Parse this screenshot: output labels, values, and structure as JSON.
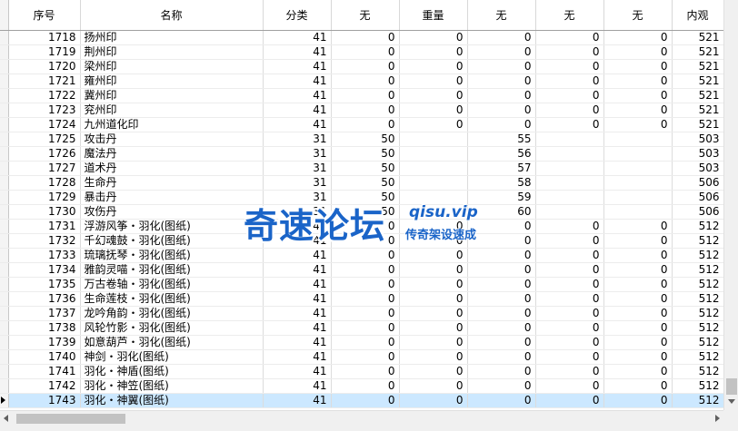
{
  "columns": [
    "序号",
    "名称",
    "分类",
    "无",
    "重量",
    "无",
    "无",
    "无",
    "内观"
  ],
  "rows": [
    [
      "1718",
      "扬州印",
      "41",
      "0",
      "0",
      "0",
      "0",
      "0",
      "521"
    ],
    [
      "1719",
      "荆州印",
      "41",
      "0",
      "0",
      "0",
      "0",
      "0",
      "521"
    ],
    [
      "1720",
      "梁州印",
      "41",
      "0",
      "0",
      "0",
      "0",
      "0",
      "521"
    ],
    [
      "1721",
      "雍州印",
      "41",
      "0",
      "0",
      "0",
      "0",
      "0",
      "521"
    ],
    [
      "1722",
      "冀州印",
      "41",
      "0",
      "0",
      "0",
      "0",
      "0",
      "521"
    ],
    [
      "1723",
      "兖州印",
      "41",
      "0",
      "0",
      "0",
      "0",
      "0",
      "521"
    ],
    [
      "1724",
      "九州道化印",
      "41",
      "0",
      "0",
      "0",
      "0",
      "0",
      "521"
    ],
    [
      "1725",
      "攻击丹",
      "31",
      "50",
      "",
      "55",
      "",
      "",
      "503"
    ],
    [
      "1726",
      "魔法丹",
      "31",
      "50",
      "",
      "56",
      "",
      "",
      "503"
    ],
    [
      "1727",
      "道术丹",
      "31",
      "50",
      "",
      "57",
      "",
      "",
      "503"
    ],
    [
      "1728",
      "生命丹",
      "31",
      "50",
      "",
      "58",
      "",
      "",
      "506"
    ],
    [
      "1729",
      "暴击丹",
      "31",
      "50",
      "",
      "59",
      "",
      "",
      "506"
    ],
    [
      "1730",
      "攻伤丹",
      "31",
      "50",
      "",
      "60",
      "",
      "",
      "506"
    ],
    [
      "1731",
      "浮游风筝・羽化(图纸)",
      "41",
      "0",
      "0",
      "0",
      "0",
      "0",
      "512"
    ],
    [
      "1732",
      "千幻魂鼓・羽化(图纸)",
      "41",
      "0",
      "0",
      "0",
      "0",
      "0",
      "512"
    ],
    [
      "1733",
      "琉璃抚琴・羽化(图纸)",
      "41",
      "0",
      "0",
      "0",
      "0",
      "0",
      "512"
    ],
    [
      "1734",
      "雅韵灵喵・羽化(图纸)",
      "41",
      "0",
      "0",
      "0",
      "0",
      "0",
      "512"
    ],
    [
      "1735",
      "万古卷轴・羽化(图纸)",
      "41",
      "0",
      "0",
      "0",
      "0",
      "0",
      "512"
    ],
    [
      "1736",
      "生命莲枝・羽化(图纸)",
      "41",
      "0",
      "0",
      "0",
      "0",
      "0",
      "512"
    ],
    [
      "1737",
      "龙吟角韵・羽化(图纸)",
      "41",
      "0",
      "0",
      "0",
      "0",
      "0",
      "512"
    ],
    [
      "1738",
      "风轮竹影・羽化(图纸)",
      "41",
      "0",
      "0",
      "0",
      "0",
      "0",
      "512"
    ],
    [
      "1739",
      "如意葫芦・羽化(图纸)",
      "41",
      "0",
      "0",
      "0",
      "0",
      "0",
      "512"
    ],
    [
      "1740",
      "神剑・羽化(图纸)",
      "41",
      "0",
      "0",
      "0",
      "0",
      "0",
      "512"
    ],
    [
      "1741",
      "羽化・神盾(图纸)",
      "41",
      "0",
      "0",
      "0",
      "0",
      "0",
      "512"
    ],
    [
      "1742",
      "羽化・神笠(图纸)",
      "41",
      "0",
      "0",
      "0",
      "0",
      "0",
      "512"
    ],
    [
      "1743",
      "羽化・神翼(图纸)",
      "41",
      "0",
      "0",
      "0",
      "0",
      "0",
      "512"
    ]
  ],
  "selected_row": "1743",
  "watermark": {
    "main": "奇速论坛",
    "url": "qisu.vip",
    "sub": "传奇架设速成"
  },
  "colors": {
    "selected_row_bg": "#cce8ff",
    "watermark": "#1a64c8"
  }
}
